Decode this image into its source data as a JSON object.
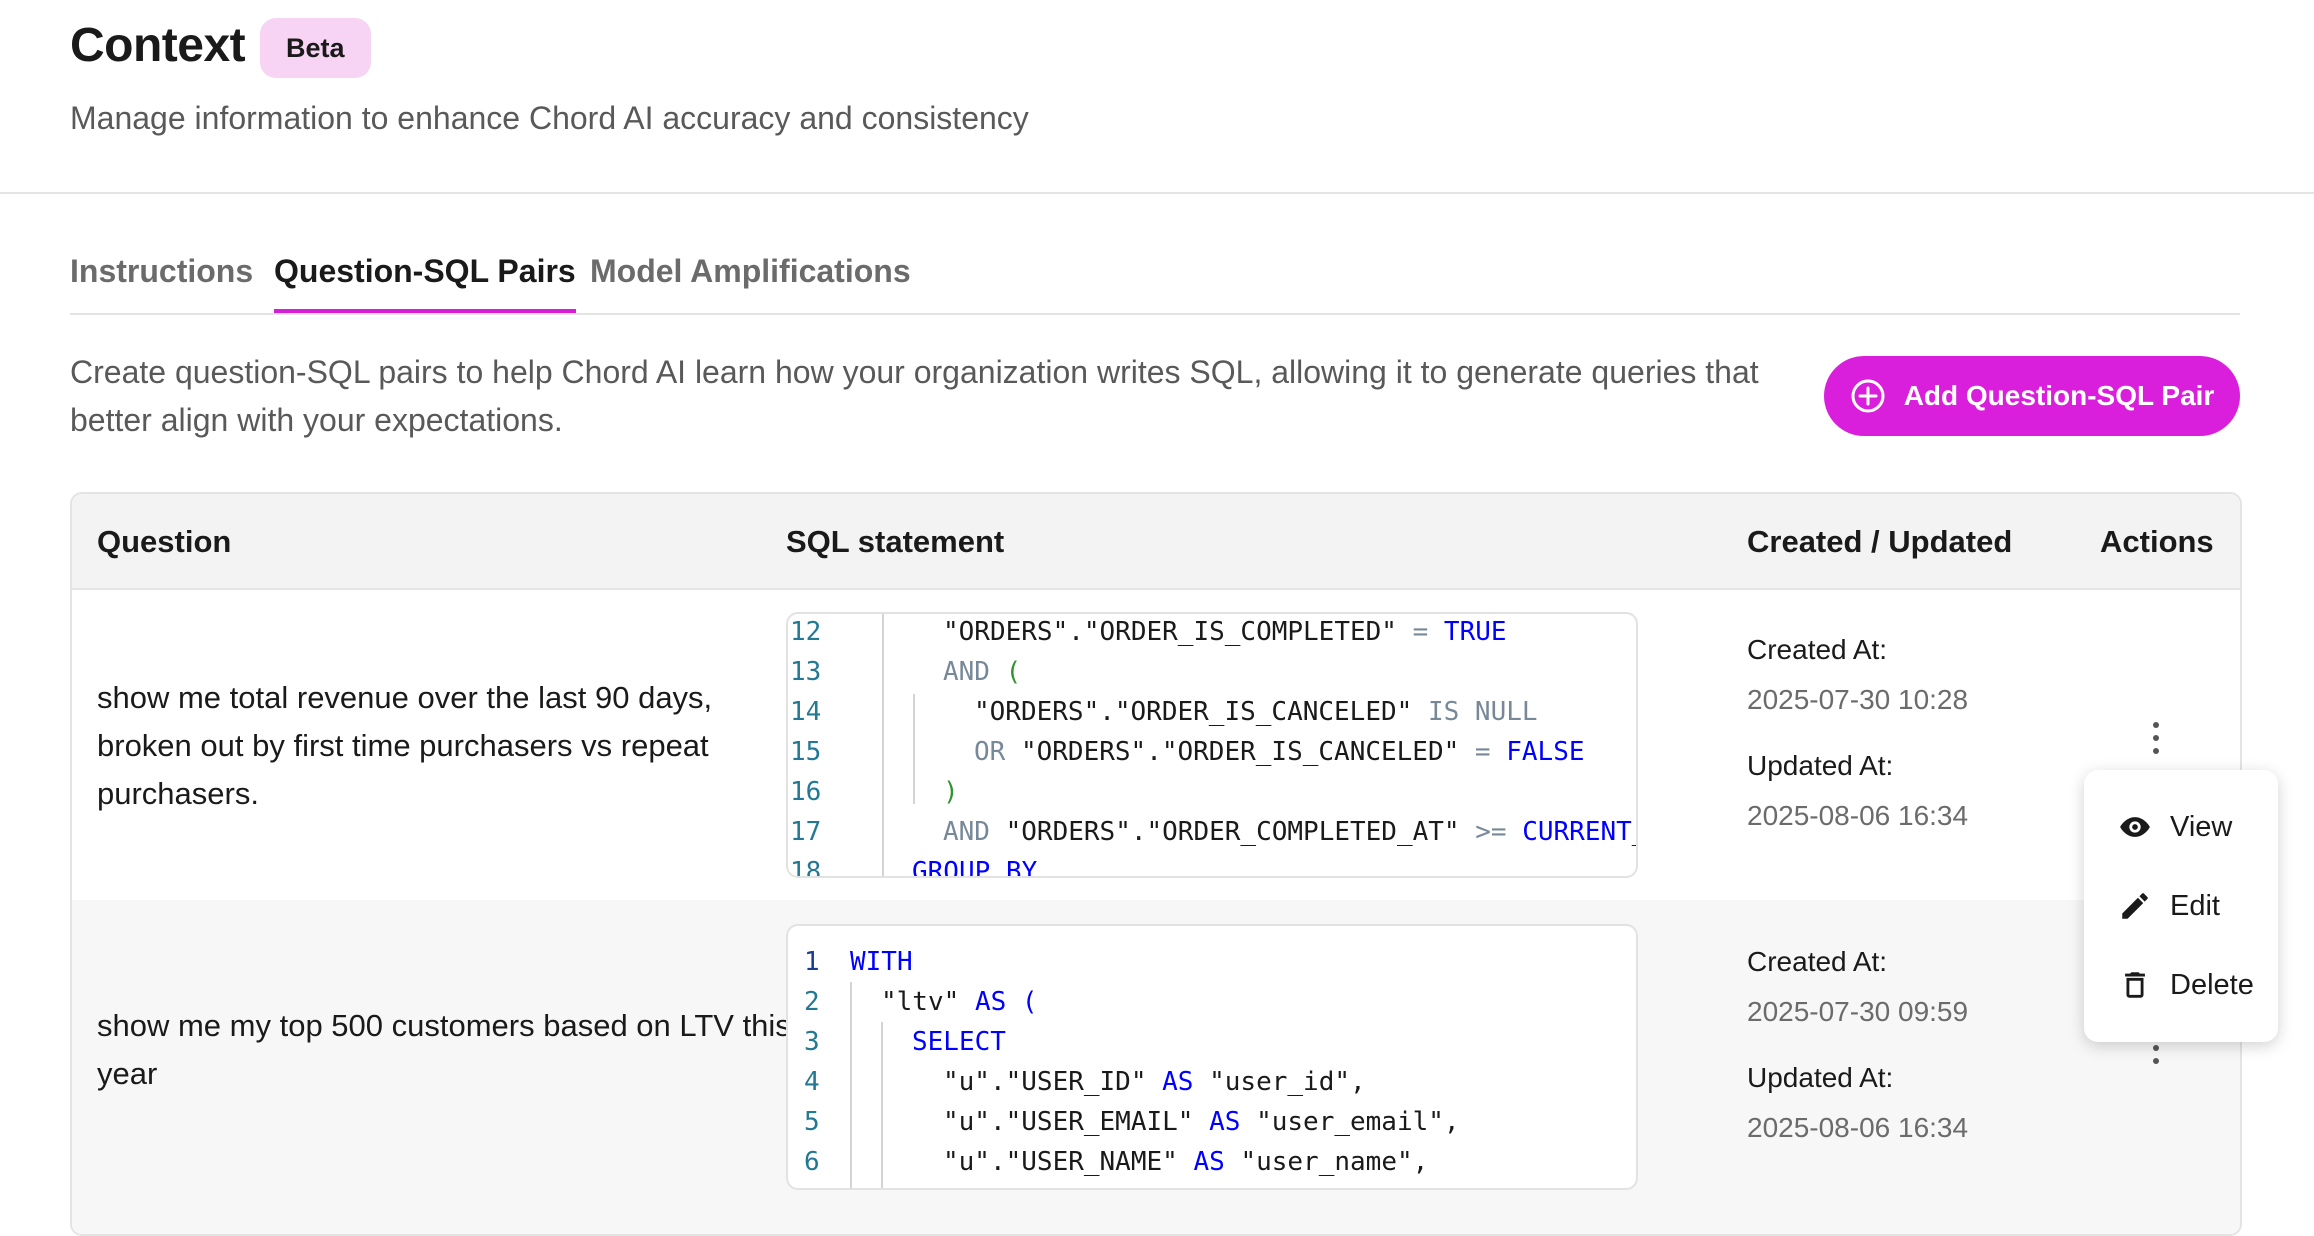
{
  "page": {
    "title": "Context",
    "badge": "Beta",
    "subtitle": "Manage information to enhance Chord AI accuracy and consistency"
  },
  "tabs": [
    {
      "label": "Instructions",
      "active": false
    },
    {
      "label": "Question-SQL Pairs",
      "active": true
    },
    {
      "label": "Model Amplifications",
      "active": false
    }
  ],
  "description": "Create question-SQL pairs to help Chord AI learn how your organization writes SQL, allowing it to generate queries that better align with your expectations.",
  "add_button": {
    "label": "Add Question-SQL Pair",
    "icon": "plus-circle-icon"
  },
  "colors": {
    "accent": "#d91fdb",
    "badge_bg": "#f7d4f3",
    "keyword": "#0000ff",
    "line_number": "#237893"
  },
  "table": {
    "headers": {
      "question": "Question",
      "sql": "SQL statement",
      "dates": "Created / Updated",
      "actions": "Actions"
    },
    "created_label": "Created At:",
    "updated_label": "Updated At:",
    "rows": [
      {
        "question": "show me total revenue over the last 90 days, broken out by first time purchasers vs repeat purchasers.",
        "created": "2025-07-30 10:28",
        "updated": "2025-08-06 16:34",
        "sql_lines": [
          {
            "n": "12",
            "text": "\"ORDERS\".\"ORDER_IS_COMPLETED\" = TRUE"
          },
          {
            "n": "13",
            "text": "AND ("
          },
          {
            "n": "14",
            "text": "\"ORDERS\".\"ORDER_IS_CANCELED\" IS NULL"
          },
          {
            "n": "15",
            "text": "OR \"ORDERS\".\"ORDER_IS_CANCELED\" = FALSE"
          },
          {
            "n": "16",
            "text": ")"
          },
          {
            "n": "17",
            "text": "AND \"ORDERS\".\"ORDER_COMPLETED_AT\" >= CURRENT_DATI"
          },
          {
            "n": "18",
            "text": "GROUP BY"
          }
        ]
      },
      {
        "question": "show me my top 500 customers based on LTV this year",
        "created": "2025-07-30 09:59",
        "updated": "2025-08-06 16:34",
        "sql_lines": [
          {
            "n": "1",
            "text": "WITH"
          },
          {
            "n": "2",
            "text": "\"ltv\" AS ("
          },
          {
            "n": "3",
            "text": "SELECT"
          },
          {
            "n": "4",
            "text": "\"u\".\"USER_ID\" AS \"user_id\","
          },
          {
            "n": "5",
            "text": "\"u\".\"USER_EMAIL\" AS \"user_email\","
          },
          {
            "n": "6",
            "text": "\"u\".\"USER_NAME\" AS \"user_name\","
          }
        ]
      }
    ]
  },
  "action_menu": [
    {
      "label": "View",
      "icon": "eye-icon"
    },
    {
      "label": "Edit",
      "icon": "pencil-icon"
    },
    {
      "label": "Delete",
      "icon": "trash-icon"
    }
  ]
}
